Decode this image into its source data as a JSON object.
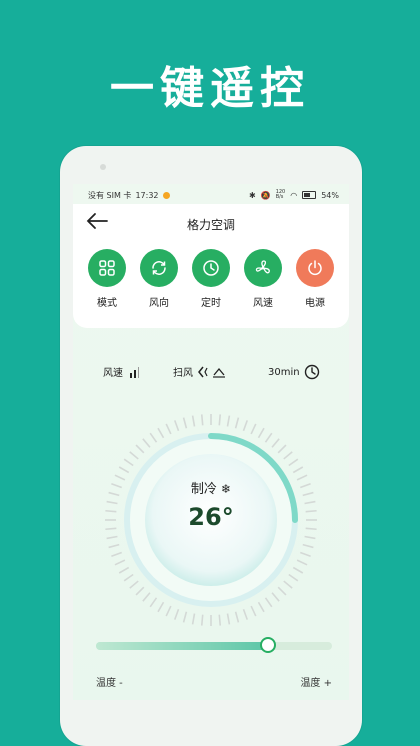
{
  "headline": "一键遥控",
  "status_bar": {
    "carrier": "没有 SIM 卡",
    "time": "17:32",
    "network_speed": "120\nB/s",
    "battery": "54%"
  },
  "header": {
    "title": "格力空调"
  },
  "controls": [
    {
      "label": "模式",
      "icon": "grid-icon"
    },
    {
      "label": "风向",
      "icon": "refresh-icon"
    },
    {
      "label": "定时",
      "icon": "clock-icon"
    },
    {
      "label": "风速",
      "icon": "fan-icon"
    },
    {
      "label": "电源",
      "icon": "power-icon"
    }
  ],
  "info": {
    "fan_speed_label": "风速",
    "swing_label": "扫风",
    "timer_label": "30min"
  },
  "dial": {
    "mode_label": "制冷",
    "temperature": "26°",
    "arc_fraction": 0.25
  },
  "slider": {
    "value_fraction": 0.73,
    "minus_label": "温度 -",
    "plus_label": "温度 +"
  },
  "colors": {
    "background": "#16ae9a",
    "accent_green": "#27ae62",
    "power_orange": "#f07a5a"
  }
}
